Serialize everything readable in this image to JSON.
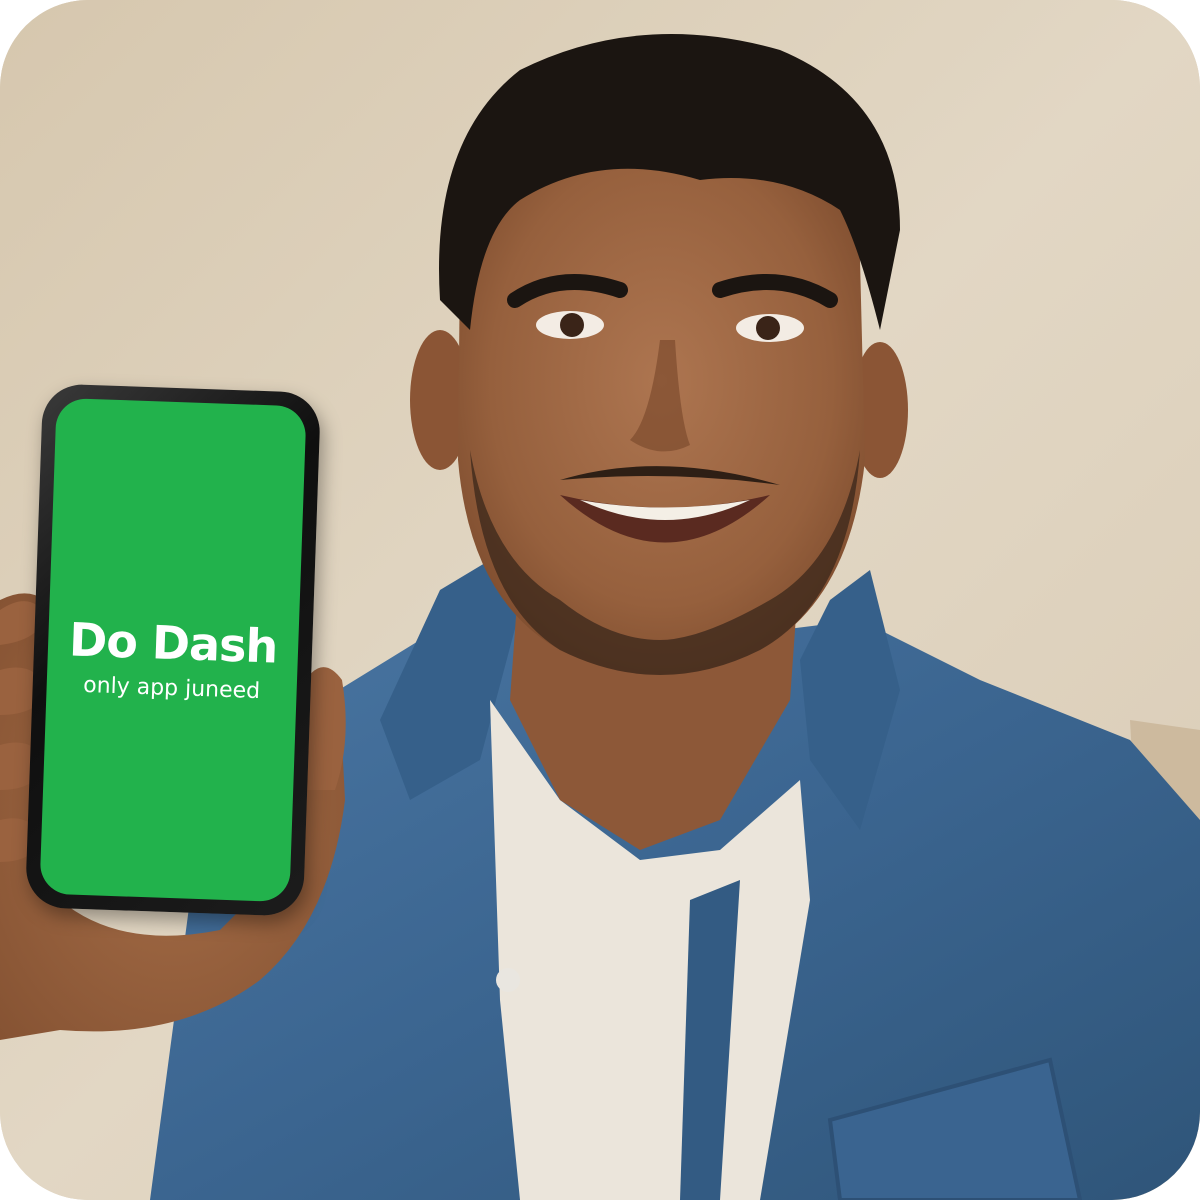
{
  "phone": {
    "app_title": "Do Dash",
    "app_tagline": "only app juneed",
    "screen_color": "#22b24c"
  },
  "palette": {
    "background": "#ddd0bb",
    "shirt": "#3f6a96",
    "tshirt": "#ece6dc",
    "skin": "#9b6541",
    "hair": "#1a1410"
  }
}
